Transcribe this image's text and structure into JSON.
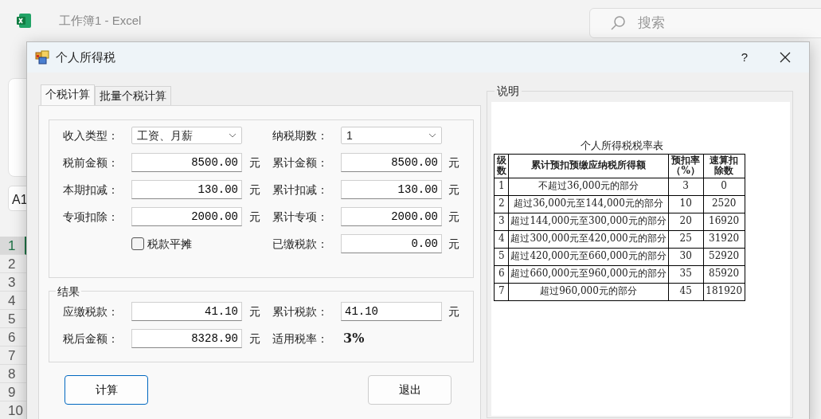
{
  "excel": {
    "title": "工作簿1 - Excel",
    "search": {
      "placeholder": "搜索"
    },
    "name_box": "A1",
    "row_headers": [
      {
        "label": "1",
        "selected": true
      },
      {
        "label": "2",
        "selected": false
      },
      {
        "label": "3",
        "selected": false
      },
      {
        "label": "4",
        "selected": false
      },
      {
        "label": "5",
        "selected": false
      },
      {
        "label": "6",
        "selected": false
      },
      {
        "label": "7",
        "selected": false
      },
      {
        "label": "8",
        "selected": false
      },
      {
        "label": "9",
        "selected": false
      },
      {
        "label": "10",
        "selected": false
      }
    ]
  },
  "dialog": {
    "title": "个人所得税",
    "help": "?",
    "tabs": [
      {
        "label": "个税计算",
        "selected": true
      },
      {
        "label": "批量个税计算",
        "selected": false
      }
    ],
    "form_rows": [
      [
        {
          "kind": "select",
          "label": "收入类型：",
          "value": "工资、月薪"
        },
        {
          "kind": "select",
          "label": "纳税期数：",
          "value": "1"
        }
      ],
      [
        {
          "kind": "input",
          "label": "税前金额：",
          "value": "8500.00",
          "unit": "元"
        },
        {
          "kind": "input",
          "label": "累计金额：",
          "value": "8500.00",
          "unit": "元"
        }
      ],
      [
        {
          "kind": "input",
          "label": "本期扣减：",
          "value": "130.00",
          "unit": "元"
        },
        {
          "kind": "input",
          "label": "累计扣减：",
          "value": "130.00",
          "unit": "元"
        }
      ],
      [
        {
          "kind": "input",
          "label": "专项扣除：",
          "value": "2000.00",
          "unit": "元"
        },
        {
          "kind": "input",
          "label": "累计专项：",
          "value": "2000.00",
          "unit": "元"
        }
      ],
      [
        {
          "kind": "checkbox",
          "label": "税款平摊",
          "checked": false
        },
        {
          "kind": "input",
          "label": "已缴税款：",
          "value": "0.00",
          "unit": "元"
        }
      ]
    ],
    "result": {
      "title": "结果",
      "rows": [
        [
          {
            "kind": "input",
            "label": "应缴税款：",
            "value": "41.10",
            "unit": "元"
          },
          {
            "kind": "input_left",
            "label": "累计税款：",
            "value": "41.10",
            "unit": "元"
          }
        ],
        [
          {
            "kind": "input",
            "label": "税后金额：",
            "value": "8328.90",
            "unit": "元"
          },
          {
            "kind": "rate",
            "label": "适用税率：",
            "value": "3%"
          }
        ]
      ]
    },
    "buttons": [
      {
        "label": "计算",
        "default": true
      },
      {
        "label": "退出",
        "default": false
      }
    ],
    "info": {
      "title": "说明",
      "table_title": "个人所得税税率表",
      "columns": [
        "级数",
        "累计预扣预缴应纳税所得额",
        "预扣率（%）",
        "速算扣除数"
      ],
      "rows": [
        [
          "1",
          "不超过36,000元的部分",
          "3",
          "0"
        ],
        [
          "2",
          "超过36,000元至144,000元的部分",
          "10",
          "2520"
        ],
        [
          "3",
          "超过144,000元至300,000元的部分",
          "20",
          "16920"
        ],
        [
          "4",
          "超过300,000元至420,000元的部分",
          "25",
          "31920"
        ],
        [
          "5",
          "超过420,000元至660,000元的部分",
          "30",
          "52920"
        ],
        [
          "6",
          "超过660,000元至960,000元的部分",
          "35",
          "85920"
        ],
        [
          "7",
          "超过960,000元的部分",
          "45",
          "181920"
        ]
      ]
    }
  }
}
